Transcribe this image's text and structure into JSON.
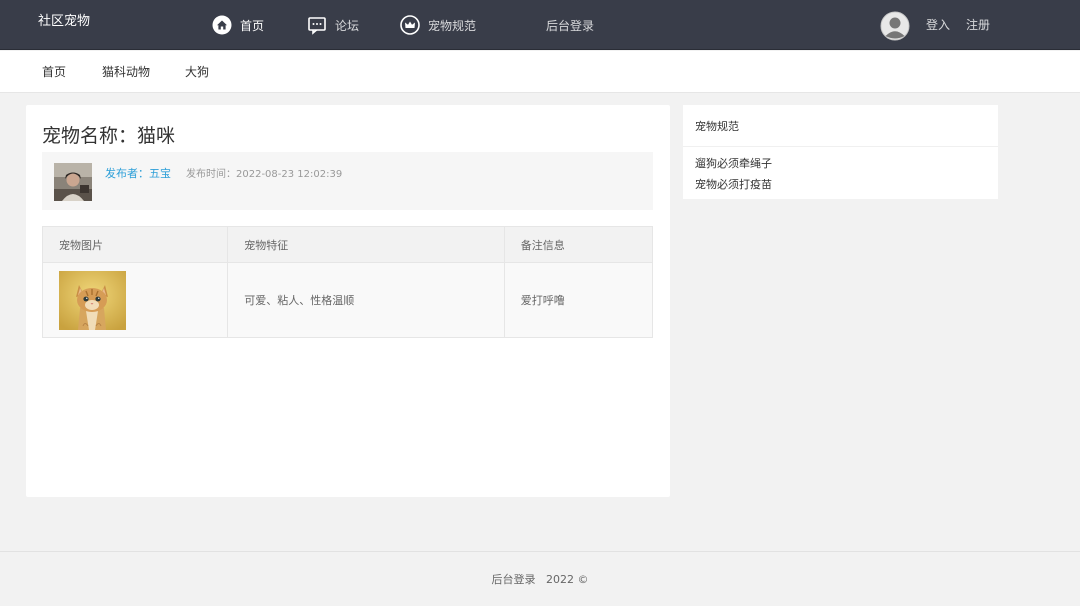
{
  "header": {
    "logo": "社区宠物",
    "nav": [
      {
        "label": "首页",
        "icon": "home-icon"
      },
      {
        "label": "论坛",
        "icon": "chat-icon"
      },
      {
        "label": "宠物规范",
        "icon": "crown-icon"
      },
      {
        "label": "后台登录"
      }
    ],
    "login": "登入",
    "register": "注册"
  },
  "subnav": [
    "首页",
    "猫科动物",
    "大狗"
  ],
  "pet": {
    "title": "宠物名称：猫咪",
    "author": "发布者：五宝",
    "time": "发布时间：2022-08-23 12:02:39",
    "table": {
      "headers": [
        "宠物图片",
        "宠物特征",
        "备注信息"
      ],
      "features": "可爱、粘人、性格温顺",
      "notes": "爱打呼噜"
    }
  },
  "sidebar": {
    "title": "宠物规范",
    "rules": [
      "遛狗必须牵绳子",
      "宠物必须打疫苗"
    ]
  },
  "footer": "后台登录   2022 ©",
  "colors": {
    "topbar": "#393d49",
    "link": "#2d9fd8",
    "background": "#f2f2f2"
  }
}
